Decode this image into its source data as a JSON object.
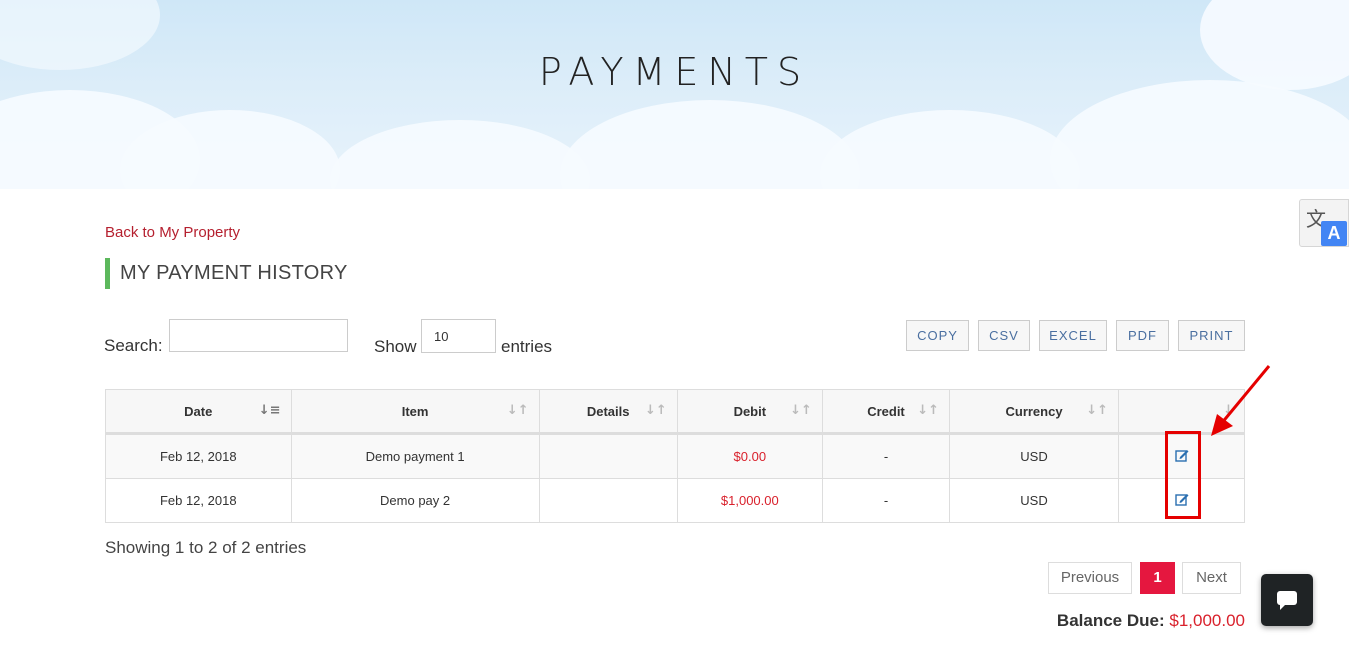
{
  "hero": {
    "title": "PAYMENTS"
  },
  "translate": {
    "zh": "文",
    "a": "A"
  },
  "back_link": "Back to My Property",
  "section_title": "MY PAYMENT HISTORY",
  "controls": {
    "search_label": "Search:",
    "search_value": "",
    "show_label": "Show",
    "length_value": "10",
    "entries_label": "entries"
  },
  "export_buttons": [
    "COPY",
    "CSV",
    "EXCEL",
    "PDF",
    "PRINT"
  ],
  "table": {
    "headers": [
      "Date",
      "Item",
      "Details",
      "Debit",
      "Credit",
      "Currency",
      ""
    ],
    "rows": [
      {
        "date": "Feb 12, 2018",
        "item": "Demo payment 1",
        "details": "",
        "debit": "$0.00",
        "credit": "-",
        "currency": "USD"
      },
      {
        "date": "Feb 12, 2018",
        "item": "Demo pay 2",
        "details": "",
        "debit": "$1,000.00",
        "credit": "-",
        "currency": "USD"
      }
    ]
  },
  "info": "Showing 1 to 2 of 2 entries",
  "pagination": {
    "previous": "Previous",
    "current": "1",
    "next": "Next"
  },
  "balance": {
    "label": "Balance Due:",
    "amount": "$1,000.00"
  },
  "colors": {
    "accent_red": "#d9212c",
    "pagination_active": "#e5173f",
    "title_bar": "#5cb85c",
    "annotation": "#e50000"
  },
  "icons": {
    "edit": "edit-icon",
    "chat": "chat-icon",
    "translate": "translate-icon",
    "sort": "sort-icon"
  }
}
